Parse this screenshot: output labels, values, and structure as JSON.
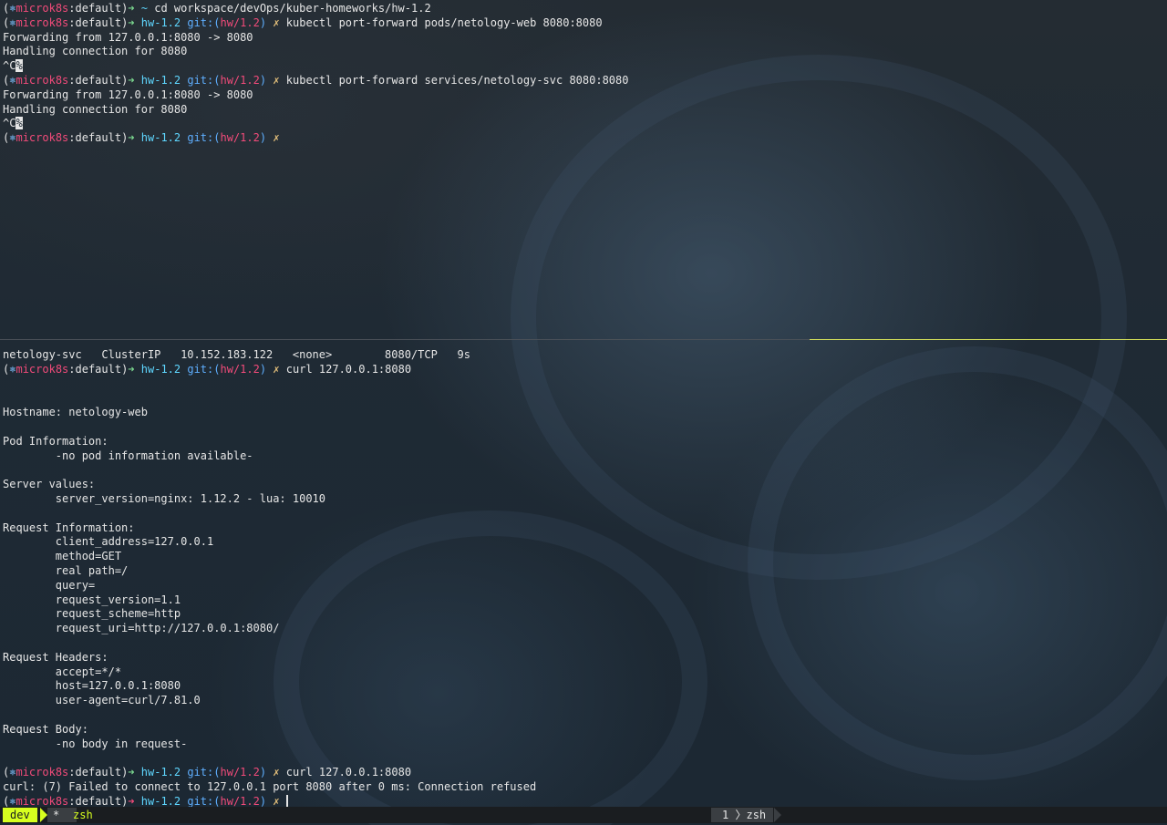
{
  "prompt": {
    "k8s_icon": "⎈",
    "context": "microk8s",
    "namespace": "default",
    "arrow": "➜",
    "dir": "hw-1.2",
    "git_label": "git:",
    "branch": "hw/1.2",
    "dirty": "✗",
    "home_dir": "~"
  },
  "top_pane": {
    "lines": [
      {
        "type": "prompt_home",
        "cmd": "cd workspace/devOps/kuber-homeworks/hw-1.2"
      },
      {
        "type": "prompt",
        "cmd": "kubectl port-forward pods/netology-web 8080:8080"
      },
      {
        "type": "output",
        "text": "Forwarding from 127.0.0.1:8080 -> 8080"
      },
      {
        "type": "output",
        "text": "Handling connection for 8080"
      },
      {
        "type": "ctrlc",
        "text": "^C",
        "sel": "%"
      },
      {
        "type": "prompt",
        "cmd": "kubectl port-forward services/netology-svc 8080:8080"
      },
      {
        "type": "output",
        "text": "Forwarding from 127.0.0.1:8080 -> 8080"
      },
      {
        "type": "output",
        "text": "Handling connection for 8080"
      },
      {
        "type": "ctrlc",
        "text": "^C",
        "sel": "%"
      },
      {
        "type": "prompt",
        "cmd": ""
      }
    ]
  },
  "bottom_pane": {
    "service_row": "netology-svc   ClusterIP   10.152.183.122   <none>        8080/TCP   9s",
    "curl_cmd": "curl 127.0.0.1:8080",
    "response": [
      "",
      "",
      "Hostname: netology-web",
      "",
      "Pod Information:",
      "        -no pod information available-",
      "",
      "Server values:",
      "        server_version=nginx: 1.12.2 - lua: 10010",
      "",
      "Request Information:",
      "        client_address=127.0.0.1",
      "        method=GET",
      "        real path=/",
      "        query=",
      "        request_version=1.1",
      "        request_scheme=http",
      "        request_uri=http://127.0.0.1:8080/",
      "",
      "Request Headers:",
      "        accept=*/*",
      "        host=127.0.0.1:8080",
      "        user-agent=curl/7.81.0",
      "",
      "Request Body:",
      "        -no body in request-",
      ""
    ],
    "curl_cmd_2": "curl 127.0.0.1:8080",
    "curl_error": "curl: (7) Failed to connect to 127.0.0.1 port 8080 after 0 ms: Connection refused",
    "fail_arrow": "➜"
  },
  "statusbar": {
    "session": "dev",
    "window_marker": "*",
    "window_name": "zsh",
    "right_index": "1",
    "right_sep": "〉",
    "right_name": "zsh"
  },
  "colors": {
    "accent": "#d7ff1f",
    "context": "#f24b7a",
    "ok_arrow": "#7bd88f",
    "dir": "#5fd7ff"
  }
}
